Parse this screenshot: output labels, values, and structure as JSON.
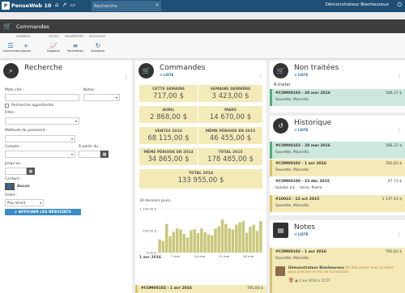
{
  "app": {
    "name": "PenseWeb 10",
    "search_placeholder": "Recherche",
    "user": "Démonstrateur Bienheureux"
  },
  "header": {
    "title": "Commandes"
  },
  "toolbar": {
    "groups": [
      "Données",
      "Outils",
      "Paramètres",
      "Affichage"
    ],
    "buttons": [
      "Commandes",
      "Ajouter",
      "Rapports",
      "Paramètres",
      "Actualiser"
    ]
  },
  "search": {
    "title": "Recherche",
    "keywords_label": "Mots clés :",
    "notes_label": "Notes :",
    "advanced_label": "Recherche approfondie",
    "filter_label": "Filtre :",
    "payment_label": "Méthode de paiement :",
    "account_label": "Compte :",
    "from_label": "À partir du :",
    "until_label": "Jusqu'au :",
    "contact_label": "Contact :",
    "contact_value": "Aucun",
    "order_label": "Ordre :",
    "order_value": "Plus récent",
    "submit_label": "AFFICHER LES RÉSULTATS"
  },
  "commandes": {
    "title": "Commandes",
    "list_label": "LISTE",
    "stats": [
      {
        "label": "CETTE SEMAINE",
        "value": "717,00 $"
      },
      {
        "label": "SEMAINE DERNIÈRE",
        "value": "3 423,00 $"
      },
      {
        "label": "AVRIL",
        "value": "2 868,00 $"
      },
      {
        "label": "MARS",
        "value": "14 670,00 $"
      },
      {
        "label": "VENTES 2016",
        "value": "68 115,00 $"
      },
      {
        "label": "MÊME PÉRIODE EN 2015",
        "value": "46 455,00 $"
      },
      {
        "label": "MÊME PÉRIODE EN 2014",
        "value": "34 865,00 $"
      },
      {
        "label": "TOTAL 2015",
        "value": "178 485,00 $"
      },
      {
        "label": "TOTAL 2014",
        "value": "133 955,00 $"
      }
    ],
    "chart_title": "30 derniers jours",
    "bottom_date": "1 avr 2016",
    "bottom_entry": {
      "id": "#COM00102 - 1 avr 2016",
      "amount": "781,83 $"
    }
  },
  "chart_data": {
    "type": "bar",
    "title": "30 derniers jours",
    "xlabel": "",
    "ylabel": "",
    "ylim": [
      0,
      1100
    ],
    "yticks": [
      "1 100,00 $",
      "550,00 $",
      "0,00 $"
    ],
    "xticks": [
      "7 mar",
      "14 mar",
      "21 mar",
      "28 mar"
    ],
    "values": [
      330,
      290,
      720,
      410,
      520,
      610,
      580,
      470,
      380,
      560,
      590,
      490,
      610,
      510,
      460,
      430,
      600,
      660,
      830,
      720,
      610,
      580,
      700,
      760,
      790,
      500,
      650,
      700,
      540,
      790
    ],
    "color": "#c9c77a"
  },
  "non_traitees": {
    "title": "Non traitées",
    "list_label": "LISTE",
    "section": "À traiter",
    "entries": [
      {
        "id": "#COM00103 - 20 mar 2016",
        "amount": "586,37 $",
        "name": "Saurette, Marcella"
      }
    ]
  },
  "historique": {
    "title": "Historique",
    "list_label": "LISTE",
    "entries": [
      {
        "id": "#COM00103 - 20 mar 2016",
        "amount": "586,37 $",
        "name": "Saurette, Marcella"
      },
      {
        "id": "#COM00102 - 1 avr 2016",
        "amount": "781,83 $",
        "name": "Saurette, Marcella"
      },
      {
        "id": "#COM00100 - 15 déc 2015",
        "amount": "97,73 $",
        "name": "Solulac Inc. - Varin, Pierre"
      },
      {
        "id": "#10022 - 12 oct 2015",
        "amount": "1 137,41 $",
        "name": "Saurette, Marcella"
      }
    ]
  },
  "notes": {
    "title": "Notes",
    "list_label": "LISTE",
    "entry": {
      "id": "#COM00102 - 1 avr 2016",
      "amount": "781,83 $",
      "name": "Saurette, Marcella"
    },
    "author": "Démonstrateur Bienheureux",
    "text": "On doit parler avec le client pour préciser le lieu de la livraison.",
    "date": "1 avr 2016 à 15:57"
  },
  "colors": {
    "topbar": "#1f4f75",
    "accent": "#3a8cc8",
    "green": "#cce8dc",
    "yellow": "#f3eab8"
  }
}
